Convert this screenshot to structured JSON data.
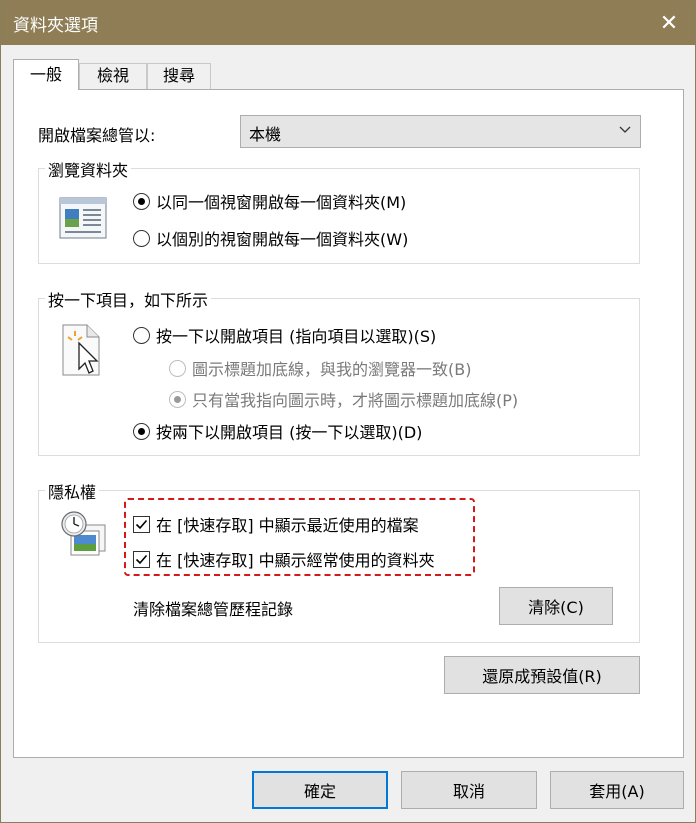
{
  "window": {
    "title": "資料夾選項"
  },
  "tabs": [
    {
      "label": "一般"
    },
    {
      "label": "檢視"
    },
    {
      "label": "搜尋"
    }
  ],
  "general": {
    "open_explorer_label": "開啟檔案總管以:",
    "open_explorer_value": "本機",
    "browse": {
      "title": "瀏覽資料夾",
      "option_same": "以同一個視窗開啟每一個資料夾(M)",
      "option_new": "以個別的視窗開啟每一個資料夾(W)"
    },
    "click": {
      "title": "按一下項目，如下所示",
      "single_click": "按一下以開啟項目 (指向項目以選取)(S)",
      "underline_browser": "圖示標題加底線，與我的瀏覽器一致(B)",
      "underline_point": "只有當我指向圖示時，才將圖示標題加底線(P)",
      "double_click": "按兩下以開啟項目 (按一下以選取)(D)"
    },
    "privacy": {
      "title": "隱私權",
      "show_recent": "在 [快速存取] 中顯示最近使用的檔案",
      "show_frequent": "在 [快速存取] 中顯示經常使用的資料夾",
      "clear_history_label": "清除檔案總管歷程記錄",
      "clear_button": "清除(C)"
    },
    "restore_defaults": "還原成預設值(R)"
  },
  "buttons": {
    "ok": "確定",
    "cancel": "取消",
    "apply": "套用(A)"
  },
  "colors": {
    "titlebar": "#8e7d55",
    "highlight_border": "#d21a1a",
    "default_button_border": "#0078d7"
  }
}
